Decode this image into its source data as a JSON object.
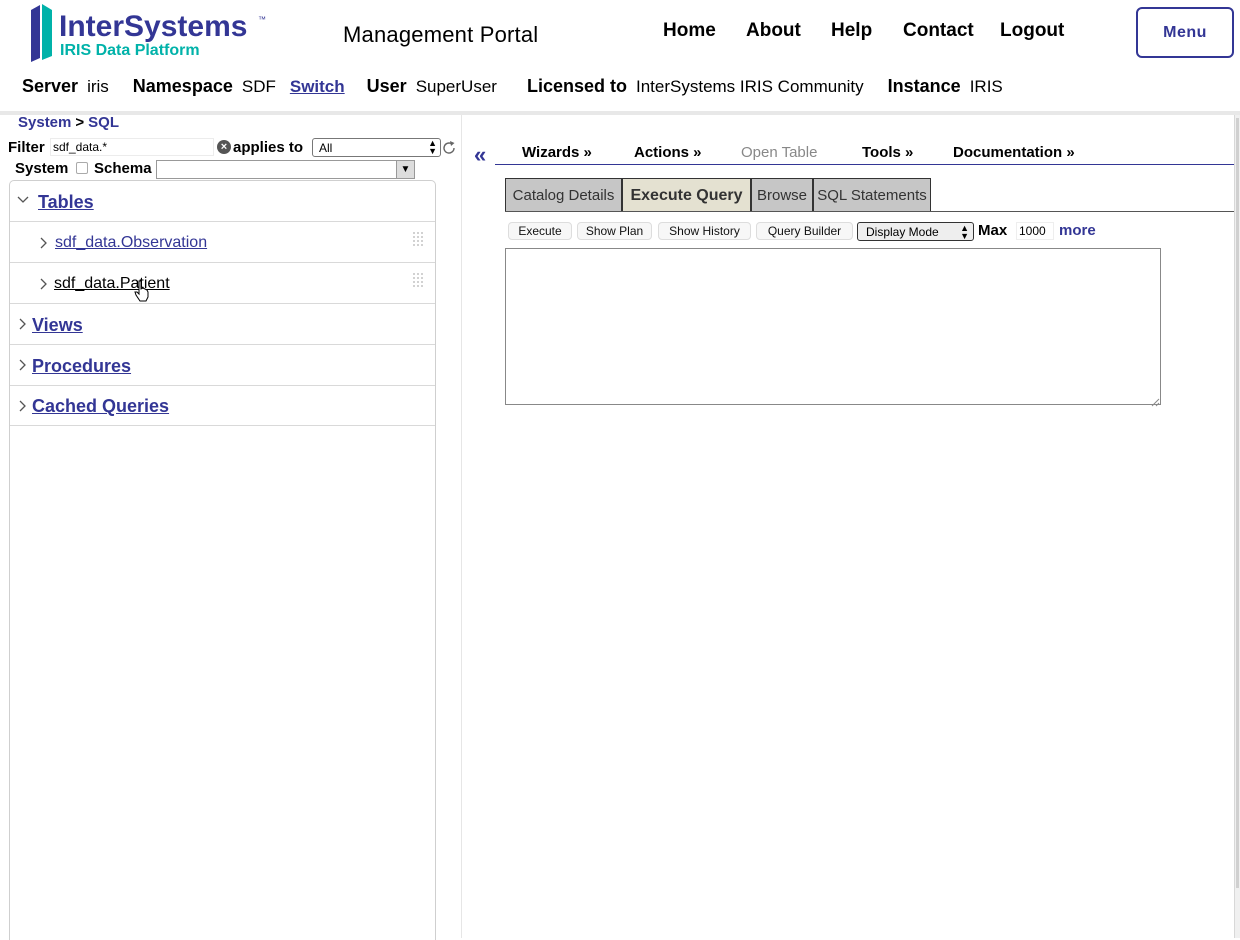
{
  "header": {
    "logo": {
      "brand": "InterSystems",
      "tm": "™",
      "subtitle": "IRIS Data Platform"
    },
    "portal_title": "Management Portal",
    "nav": [
      "Home",
      "About",
      "Help",
      "Contact",
      "Logout"
    ],
    "menu_label": "Menu"
  },
  "info": {
    "server_label": "Server",
    "server": "iris",
    "namespace_label": "Namespace",
    "namespace": "SDF",
    "switch_label": "Switch",
    "user_label": "User",
    "user": "SuperUser",
    "licensed_label": "Licensed to",
    "licensed": "InterSystems IRIS Community",
    "instance_label": "Instance",
    "instance": "IRIS"
  },
  "breadcrumb": {
    "root": "System",
    "sep": ">",
    "current": "SQL"
  },
  "filter": {
    "label": "Filter",
    "value": "sdf_data.*",
    "applies_label": "applies to",
    "applies_value": "All",
    "system_label": "System",
    "schema_label": "Schema",
    "schema_value": ""
  },
  "tree": {
    "tables": "Tables",
    "table_items": [
      "sdf_data.Observation",
      "sdf_data.Patient"
    ],
    "views": "Views",
    "procedures": "Procedures",
    "cached_queries": "Cached Queries"
  },
  "toolbar": {
    "wizards": "Wizards »",
    "actions": "Actions »",
    "open_table": "Open Table",
    "tools": "Tools »",
    "documentation": "Documentation »"
  },
  "tabs": [
    "Catalog Details",
    "Execute Query",
    "Browse",
    "SQL Statements"
  ],
  "active_tab": "Execute Query",
  "query": {
    "execute": "Execute",
    "show_plan": "Show Plan",
    "show_history": "Show History",
    "query_builder": "Query Builder",
    "display_mode": "Display Mode",
    "max_label": "Max",
    "max_value": "1000",
    "more": "more",
    "text": ""
  },
  "colors": {
    "accent": "#333695",
    "logo_teal": "#00b2a9",
    "tab_active": "#e4e1d1",
    "tab": "#c6c6c6"
  }
}
